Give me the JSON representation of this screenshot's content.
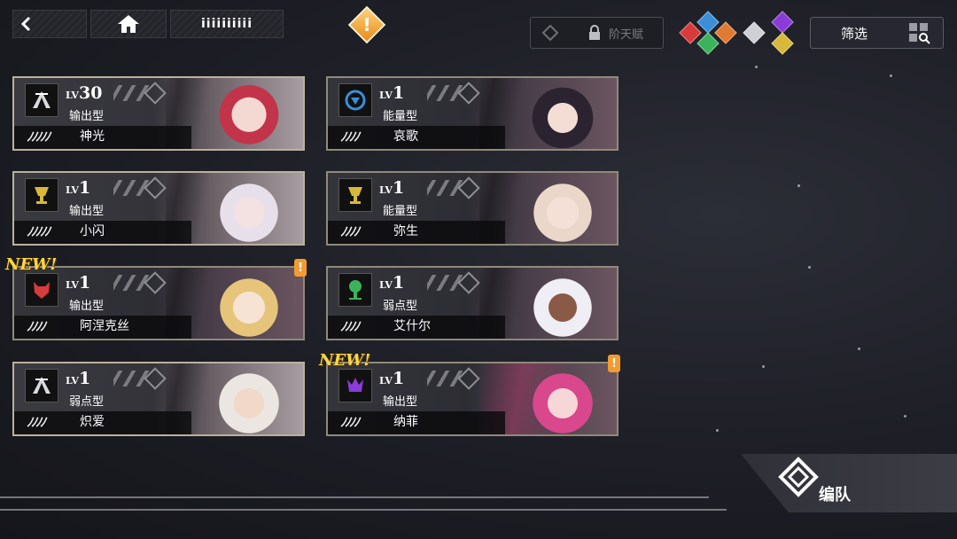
{
  "topbar": {
    "player_name": "iiiiiiiiii",
    "alert_glyph": "!",
    "talent_label": "阶天赋",
    "filter_label": "筛选"
  },
  "cards": [
    {
      "level": "30",
      "level_prefix": "LV",
      "role": "输出型",
      "stars": 5,
      "star_glyphs": "ﾉﾉﾉﾉﾉ",
      "name": "神光",
      "faction": "wing",
      "new": false,
      "alert": false
    },
    {
      "level": "1",
      "level_prefix": "LV",
      "role": "能量型",
      "stars": 4,
      "star_glyphs": "ﾉﾉﾉﾉ",
      "name": "哀歌",
      "faction": "shield-blue",
      "new": false,
      "alert": false
    },
    {
      "level": "1",
      "level_prefix": "LV",
      "role": "输出型",
      "stars": 5,
      "star_glyphs": "ﾉﾉﾉﾉﾉ",
      "name": "小闪",
      "faction": "chalice-gold",
      "new": false,
      "alert": false
    },
    {
      "level": "1",
      "level_prefix": "LV",
      "role": "能量型",
      "stars": 4,
      "star_glyphs": "ﾉﾉﾉﾉ",
      "name": "弥生",
      "faction": "chalice-gold",
      "new": false,
      "alert": false
    },
    {
      "level": "1",
      "level_prefix": "LV",
      "role": "输出型",
      "stars": 4,
      "star_glyphs": "ﾉﾉﾉﾉ",
      "name": "阿涅克丝",
      "faction": "wolf-red",
      "new": true,
      "alert": true
    },
    {
      "level": "1",
      "level_prefix": "LV",
      "role": "弱点型",
      "stars": 4,
      "star_glyphs": "ﾉﾉﾉﾉ",
      "name": "艾什尔",
      "faction": "tree-green",
      "new": false,
      "alert": false
    },
    {
      "level": "1",
      "level_prefix": "LV",
      "role": "弱点型",
      "stars": 4,
      "star_glyphs": "ﾉﾉﾉﾉ",
      "name": "炽爱",
      "faction": "wing",
      "new": false,
      "alert": false
    },
    {
      "level": "1",
      "level_prefix": "LV",
      "role": "输出型",
      "stars": 4,
      "star_glyphs": "ﾉﾉﾉﾉ",
      "name": "纳菲",
      "faction": "crown-purple",
      "new": true,
      "alert": true
    }
  ],
  "new_label": "NEW!",
  "alert_glyph": "!",
  "team_button_label": "编队",
  "colors": {
    "accent_orange": "#f29b2f",
    "new_gold": "#ffd640",
    "faction_red": "#d83b3b",
    "faction_blue": "#3b8ed8",
    "faction_green": "#3bb35c",
    "faction_orange": "#e07a32",
    "faction_purple": "#8a3bd8",
    "faction_gold": "#d8b83b"
  },
  "icons": {
    "back": "arrow-left-icon",
    "home": "home-icon",
    "talent": "lock-icon",
    "filter": "grid-search-icon",
    "team": "knot-icon"
  }
}
